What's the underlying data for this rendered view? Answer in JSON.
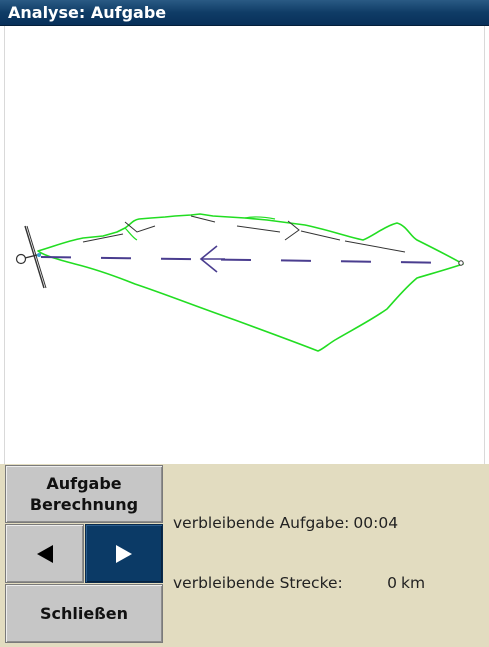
{
  "window": {
    "title": "Analyse: Aufgabe"
  },
  "buttons": {
    "task_calc_line1": "Aufgabe",
    "task_calc_line2": "Berechnung",
    "prev_glyph": "◀",
    "next_glyph": "▶",
    "close_label": "Schließen"
  },
  "info": {
    "remaining_task_label": "verbleibende Aufgabe:",
    "remaining_task_value": "00:04",
    "remaining_distance_label": "verbleibende Strecke:",
    "remaining_distance_value": "0",
    "remaining_distance_unit": "km"
  },
  "colors": {
    "title_bar": "#0f3c66",
    "flight_trace": "#22dd22",
    "task_line": "#4a3d8f",
    "next_button_active": "#0b3a66",
    "panel_bg": "#e2dcc0"
  },
  "icons": {
    "glider": "glider-icon",
    "prev": "triangle-left-icon",
    "next": "triangle-right-icon"
  }
}
